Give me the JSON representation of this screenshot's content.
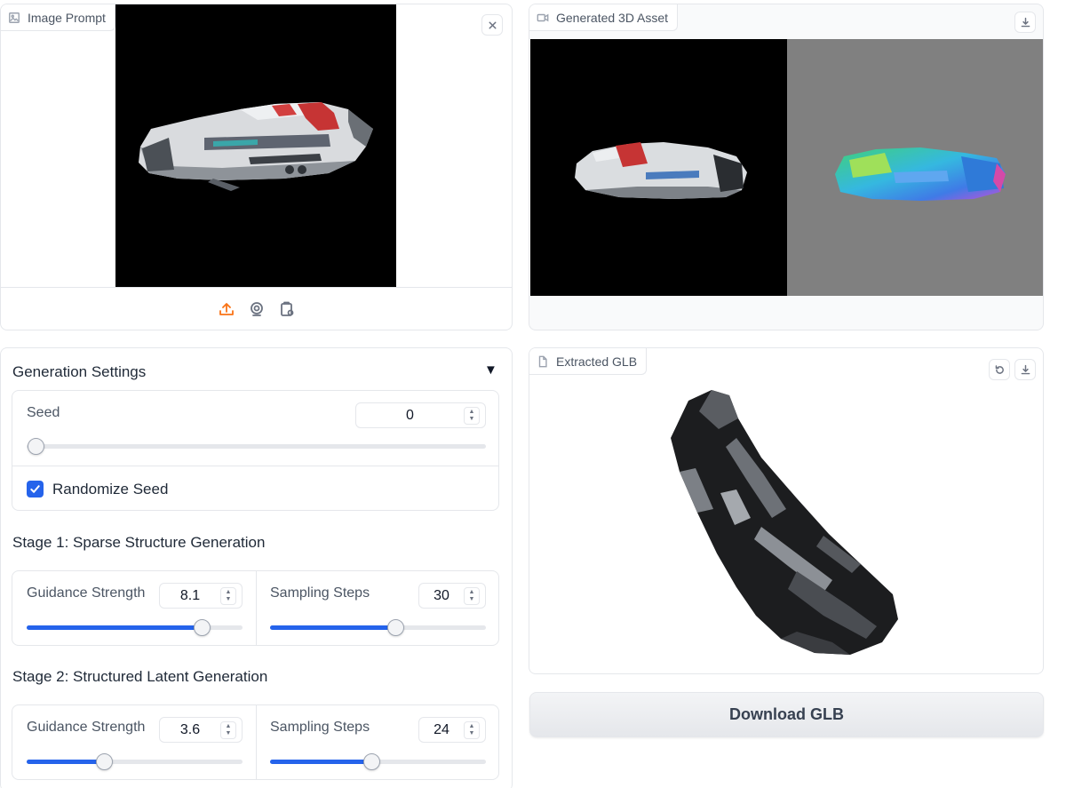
{
  "prompt_panel": {
    "label": "Image Prompt",
    "icons": [
      "image-icon",
      "close-icon",
      "upload-icon",
      "webcam-icon",
      "clipboard-icon"
    ]
  },
  "asset_panel": {
    "label": "Generated 3D Asset",
    "icons": [
      "video-icon",
      "download-icon"
    ]
  },
  "settings": {
    "title": "Generation Settings",
    "toggle": "▼",
    "seed": {
      "label": "Seed",
      "value": "0",
      "slider_fraction": 0.0
    },
    "randomize": {
      "label": "Randomize Seed",
      "checked": true
    },
    "stage1": {
      "title": "Stage 1: Sparse Structure Generation",
      "guidance": {
        "label": "Guidance Strength",
        "value": "8.1",
        "slider_fraction": 0.81
      },
      "steps": {
        "label": "Sampling Steps",
        "value": "30",
        "slider_fraction": 0.58
      }
    },
    "stage2": {
      "title": "Stage 2: Structured Latent Generation",
      "guidance": {
        "label": "Guidance Strength",
        "value": "3.6",
        "slider_fraction": 0.36
      },
      "steps": {
        "label": "Sampling Steps",
        "value": "24",
        "slider_fraction": 0.47
      }
    }
  },
  "glb_panel": {
    "label": "Extracted GLB",
    "icons": [
      "file-icon",
      "reset-icon",
      "download-icon"
    ]
  },
  "download_button": {
    "label": "Download GLB"
  },
  "colors": {
    "accent": "#2563eb",
    "upload_orange": "#f97316"
  }
}
